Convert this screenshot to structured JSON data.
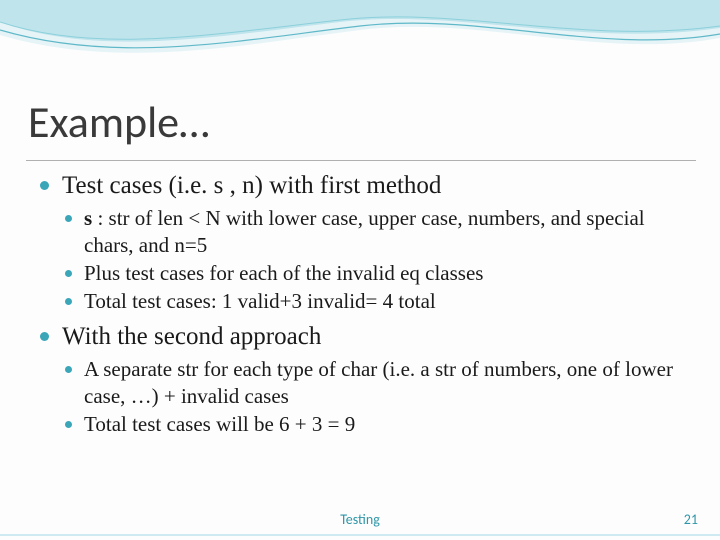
{
  "title": "Example…",
  "bullets": {
    "b1": "Test cases (i.e. s , n) with first method",
    "b1_1a": "s",
    "b1_1b": " : str of len < N with lower case, upper case, numbers, and special chars, and n=5",
    "b1_2": "Plus test cases for each of the invalid eq classes",
    "b1_3": "Total test cases: 1 valid+3 invalid= 4 total",
    "b2": "With the second approach",
    "b2_1": "A separate str for each type of char (i.e. a str of numbers, one of lower case, …) + invalid cases",
    "b2_2": "Total test cases will be 6 + 3 = 9"
  },
  "footer": "Testing",
  "page": "21"
}
